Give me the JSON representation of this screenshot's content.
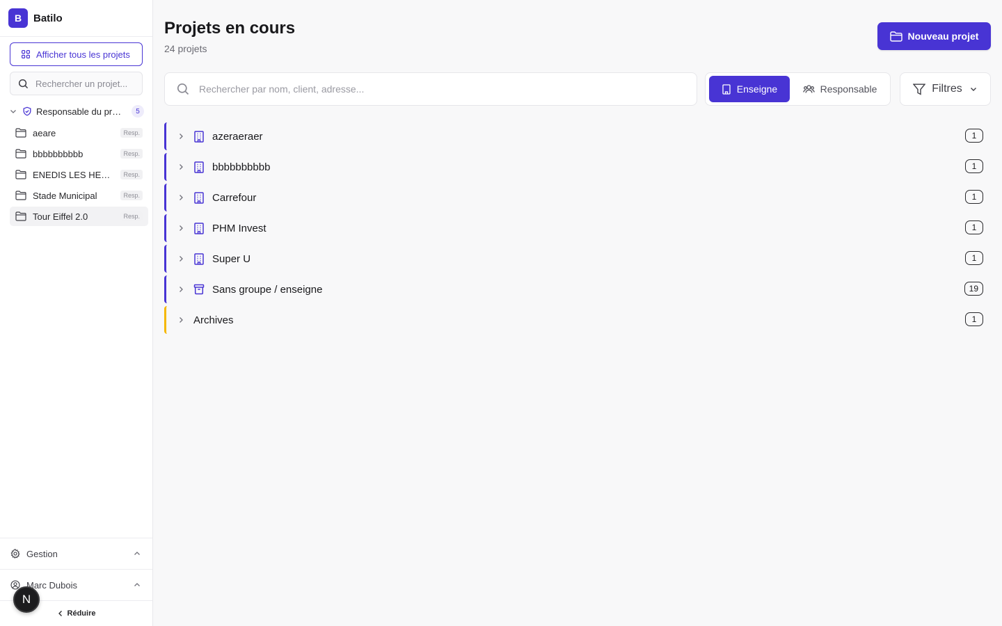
{
  "app": {
    "logo_letter": "B",
    "name": "Batilo"
  },
  "sidebar": {
    "show_all_label": "Afficher tous les projets",
    "search_placeholder": "Rechercher un projet...",
    "group": {
      "title": "Responsable du projet",
      "count": "5"
    },
    "projects": [
      {
        "name": "aeare",
        "badge": "Resp."
      },
      {
        "name": "bbbbbbbbbb",
        "badge": "Resp."
      },
      {
        "name": "ENEDIS LES HERBIERS",
        "badge": "Resp."
      },
      {
        "name": "Stade Municipal",
        "badge": "Resp."
      },
      {
        "name": "Tour Eiffel 2.0",
        "badge": "Resp."
      }
    ],
    "gestion_label": "Gestion",
    "user_name": "Marc Dubois",
    "reduce_label": "Réduire",
    "n_badge": "N"
  },
  "main": {
    "title": "Projets en cours",
    "subtitle": "24 projets",
    "new_project_label": "Nouveau projet",
    "search_placeholder": "Rechercher par nom, client, adresse...",
    "toggle": {
      "enseigne": "Enseigne",
      "responsable": "Responsable"
    },
    "filters_label": "Filtres",
    "groups": [
      {
        "name": "azeraeraer",
        "count": "1",
        "icon": "building-icon"
      },
      {
        "name": "bbbbbbbbbb",
        "count": "1",
        "icon": "building-icon"
      },
      {
        "name": "Carrefour",
        "count": "1",
        "icon": "building-icon"
      },
      {
        "name": "PHM Invest",
        "count": "1",
        "icon": "building-icon"
      },
      {
        "name": "Super U",
        "count": "1",
        "icon": "building-icon"
      },
      {
        "name": "Sans groupe / enseigne",
        "count": "19",
        "icon": "archive-box-icon"
      },
      {
        "name": "Archives",
        "count": "1",
        "icon": ""
      }
    ]
  },
  "colors": {
    "accent": "#4834d4",
    "archive": "#f5b800"
  }
}
